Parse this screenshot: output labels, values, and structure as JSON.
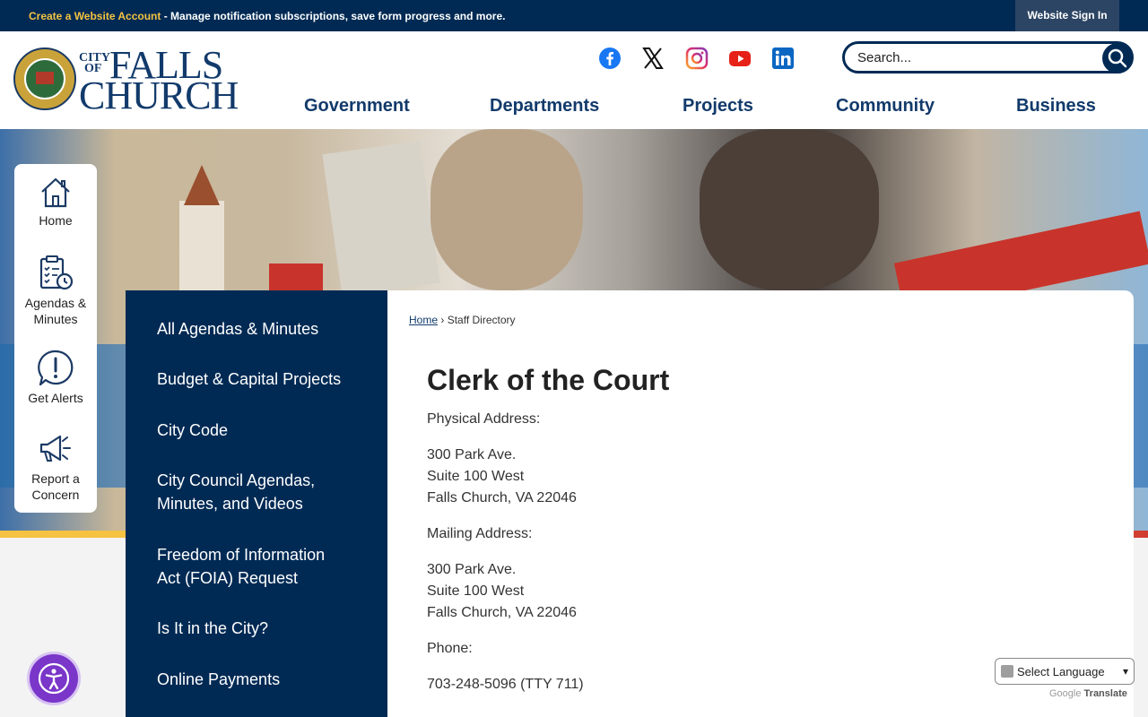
{
  "topbar": {
    "create_account": "Create a Website Account",
    "message": " - Manage notification subscriptions, save form progress and more.",
    "sign_in": "Website Sign In"
  },
  "logo": {
    "city": "CITY",
    "of": "OF",
    "falls": "FALLS",
    "church": "CHURCH"
  },
  "social": [
    "facebook-icon",
    "x-icon",
    "instagram-icon",
    "youtube-icon",
    "linkedin-icon"
  ],
  "search": {
    "placeholder": "Search..."
  },
  "nav": {
    "government": "Government",
    "departments": "Departments",
    "projects": "Projects",
    "community": "Community",
    "business": "Business"
  },
  "quick_links": {
    "home": "Home",
    "agendas_line1": "Agendas &",
    "agendas_line2": "Minutes",
    "alerts": "Get Alerts",
    "report_line1": "Report a",
    "report_line2": "Concern"
  },
  "side_menu": {
    "item1": "All Agendas & Minutes",
    "item2": "Budget & Capital Projects",
    "item3": "City Code",
    "item4_line1": "City Council Agendas,",
    "item4_line2": "Minutes, and Videos",
    "item5_line1": "Freedom of Information",
    "item5_line2": "Act (FOIA) Request",
    "item6": "Is It in the City?",
    "item7": "Online Payments"
  },
  "breadcrumb": {
    "home": "Home",
    "separator": "›",
    "current": "Staff Directory"
  },
  "page": {
    "title": "Clerk of the Court",
    "physical_label": "Physical Address:",
    "physical_line1": "300 Park Ave.",
    "physical_line2": "Suite 100 West",
    "physical_line3": "Falls Church, VA 22046",
    "mailing_label": "Mailing Address:",
    "mailing_line1": "300 Park Ave.",
    "mailing_line2": "Suite 100 West",
    "mailing_line3": "Falls Church, VA 22046",
    "phone_label": "Phone:",
    "phone": "703-248-5096 (TTY 711)"
  },
  "translate": {
    "select": "Select Language",
    "powered_google": "Google",
    "powered_translate": "Translate"
  },
  "colors": {
    "navy": "#002a54",
    "gold": "#f5c242",
    "accessibility_purple": "#7a35c9"
  }
}
